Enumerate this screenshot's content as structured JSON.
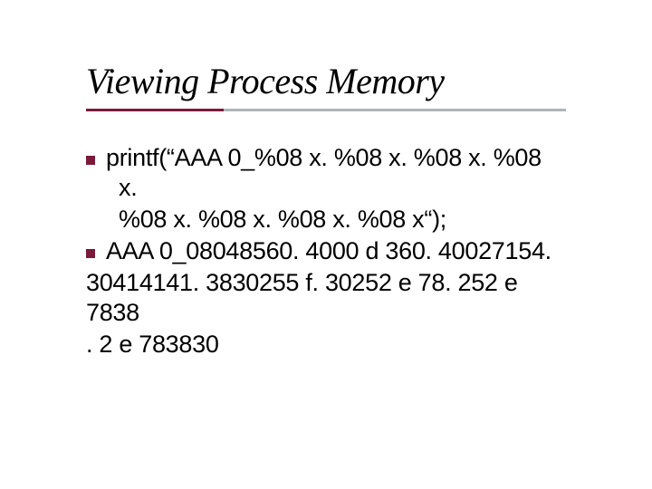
{
  "slide": {
    "title": "Viewing Process Memory",
    "bullet1_line1": "printf(“AAA 0_%08 x. %08 x. %08 x. %08 x.",
    "bullet1_line2": "%08 x. %08 x. %08 x. %08 x“);",
    "bullet2_line1": "AAA 0_08048560. 4000 d 360. 40027154.",
    "bullet2_line2": "30414141. 3830255 f. 30252 e 78. 252 e 7838",
    "bullet2_line3": ". 2 e 783830"
  }
}
